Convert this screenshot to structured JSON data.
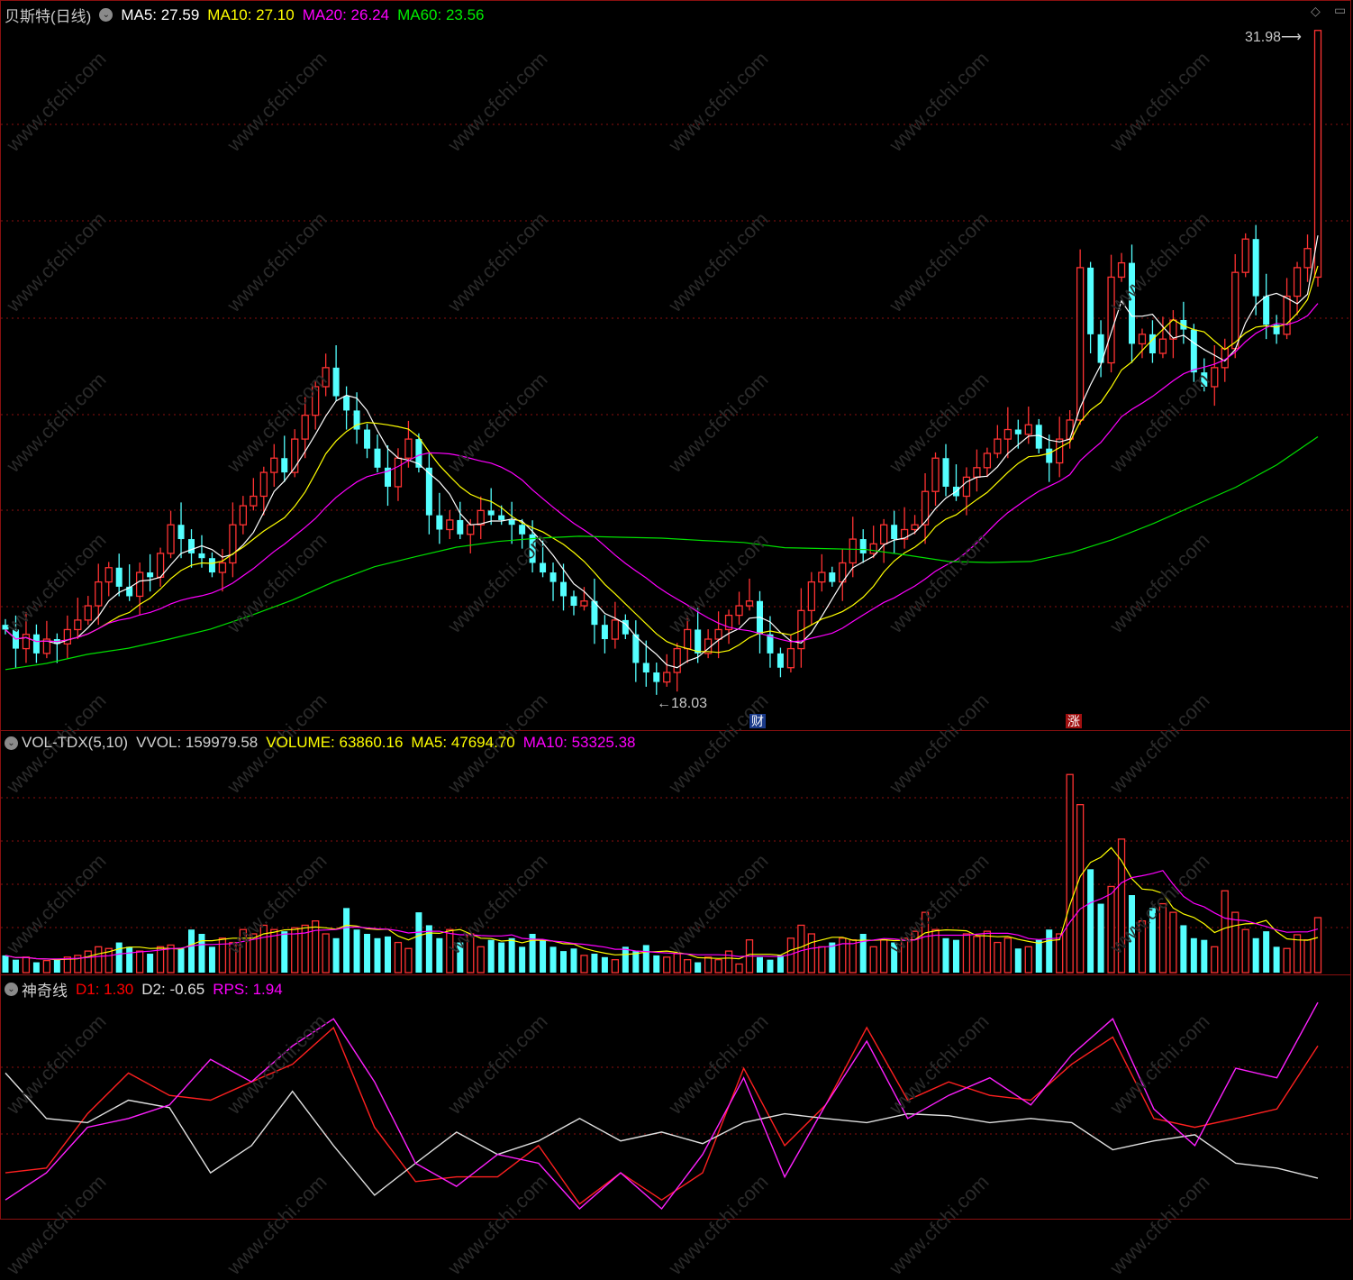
{
  "price_header": {
    "title": "贝斯特(日线)",
    "ma5": "MA5: 27.59",
    "ma10": "MA10: 27.10",
    "ma20": "MA20: 26.24",
    "ma60": "MA60: 23.56"
  },
  "volume_header": {
    "name": "VOL-TDX(5,10)",
    "vvol": "VVOL: 159979.58",
    "volume": "VOLUME: 63860.16",
    "ma5": "MA5: 47694.70",
    "ma10": "MA10: 53325.38"
  },
  "indicator_header": {
    "name": "神奇线",
    "d1": "D1: 1.30",
    "d2": "D2: -0.65",
    "rps": "RPS: 1.94"
  },
  "annotations": {
    "high_label": "31.98",
    "low_label": "18.03",
    "badge_finance": "财",
    "badge_limit_up": "涨"
  },
  "watermark": "www.cfchi.com",
  "colors": {
    "up": "#ff3232",
    "down": "#54ffff",
    "ma5": "#ffffff",
    "ma10": "#ffff00",
    "ma20": "#ff00ff",
    "ma60": "#00e000",
    "d1": "#ff2020",
    "d2": "#e0e0e0",
    "rps": "#ff20ff",
    "grid": "#8a1010"
  },
  "chart_data": [
    {
      "type": "candlestick",
      "title": "贝斯特(日线)",
      "ylim": [
        17.27,
        32.6
      ],
      "high": 31.98,
      "low": 18.03,
      "closes": [
        19.4,
        19.0,
        19.3,
        18.9,
        19.2,
        19.1,
        19.4,
        19.6,
        19.9,
        20.4,
        20.7,
        20.3,
        20.1,
        20.6,
        20.5,
        21.0,
        21.6,
        21.3,
        21.0,
        20.9,
        20.6,
        20.8,
        21.6,
        22.0,
        22.2,
        22.7,
        23.0,
        22.7,
        23.4,
        23.9,
        24.5,
        24.9,
        24.3,
        24.0,
        23.6,
        23.2,
        22.8,
        22.4,
        23.0,
        23.4,
        22.8,
        21.8,
        21.5,
        21.7,
        21.4,
        21.6,
        21.9,
        21.8,
        21.7,
        21.6,
        21.4,
        20.8,
        20.6,
        20.4,
        20.1,
        19.9,
        20.0,
        19.5,
        19.2,
        19.6,
        19.3,
        18.7,
        18.5,
        18.3,
        18.5,
        19.0,
        19.4,
        18.9,
        19.2,
        19.4,
        19.7,
        19.9,
        20.0,
        19.3,
        18.9,
        18.6,
        19.0,
        19.8,
        20.4,
        20.6,
        20.4,
        20.8,
        21.3,
        21.0,
        21.2,
        21.6,
        21.3,
        21.5,
        21.6,
        22.3,
        23.0,
        22.4,
        22.2,
        22.6,
        22.8,
        23.1,
        23.4,
        23.6,
        23.5,
        23.7,
        23.2,
        22.9,
        23.4,
        23.8,
        27.0,
        25.6,
        25.0,
        26.8,
        27.1,
        25.4,
        25.6,
        25.2,
        25.5,
        25.9,
        25.7,
        24.8,
        24.5,
        24.9,
        25.3,
        26.9,
        27.6,
        26.4,
        25.8,
        25.6,
        26.4,
        27.0,
        27.4,
        31.98
      ],
      "ma60_sampled": [
        18.56,
        18.69,
        18.88,
        19.01,
        19.2,
        19.41,
        19.7,
        20.02,
        20.4,
        20.72,
        20.93,
        21.13,
        21.25,
        21.32,
        21.36,
        21.34,
        21.32,
        21.27,
        21.23,
        21.12,
        21.1,
        21.08,
        20.96,
        20.83,
        20.81,
        20.83,
        21.02,
        21.29,
        21.63,
        22.01,
        22.39,
        22.86,
        23.45
      ]
    },
    {
      "type": "bar",
      "title": "VOL-TDX(5,10)",
      "ylim": [
        0,
        270000
      ],
      "values_thousands": [
        20,
        15,
        18,
        12,
        14,
        16,
        18,
        20,
        25,
        30,
        28,
        35,
        30,
        25,
        22,
        30,
        32,
        28,
        50,
        45,
        30,
        40,
        35,
        50,
        45,
        55,
        50,
        48,
        52,
        55,
        60,
        45,
        40,
        75,
        50,
        45,
        40,
        42,
        35,
        28,
        70,
        55,
        40,
        50,
        35,
        45,
        30,
        38,
        35,
        40,
        30,
        45,
        38,
        30,
        25,
        28,
        20,
        22,
        18,
        15,
        30,
        25,
        32,
        20,
        18,
        22,
        15,
        12,
        18,
        15,
        25,
        10,
        38,
        18,
        15,
        20,
        40,
        55,
        45,
        30,
        35,
        40,
        38,
        45,
        30,
        38,
        35,
        40,
        48,
        70,
        50,
        40,
        38,
        45,
        42,
        48,
        35,
        40,
        28,
        30,
        38,
        50,
        45,
        230,
        195,
        120,
        80,
        100,
        155,
        90,
        60,
        75,
        80,
        70,
        55,
        40,
        38,
        30,
        95,
        70,
        50,
        40,
        48,
        30,
        28,
        44,
        38,
        63.86
      ]
    },
    {
      "type": "line",
      "title": "神奇线",
      "ylim": [
        -1.26,
        2.34
      ],
      "series": [
        {
          "name": "D1",
          "values": [
            -0.57,
            -0.5,
            0.3,
            0.9,
            0.57,
            0.5,
            0.77,
            1.03,
            1.57,
            0.1,
            -0.7,
            -0.63,
            -0.63,
            -0.17,
            -1.03,
            -0.57,
            -0.97,
            -0.57,
            0.97,
            -0.17,
            0.43,
            1.57,
            0.5,
            0.77,
            0.57,
            0.5,
            1.03,
            1.43,
            0.23,
            0.1,
            0.23,
            0.37,
            1.3
          ]
        },
        {
          "name": "D2",
          "values": [
            0.9,
            0.23,
            0.17,
            0.5,
            0.39,
            -0.57,
            -0.17,
            0.63,
            -0.17,
            -0.9,
            -0.43,
            0.03,
            -0.3,
            -0.1,
            0.23,
            -0.1,
            0.03,
            -0.14,
            0.17,
            0.3,
            0.23,
            0.17,
            0.3,
            0.27,
            0.17,
            0.23,
            0.17,
            -0.23,
            -0.1,
            -0.01,
            -0.43,
            -0.5,
            -0.65
          ]
        },
        {
          "name": "RPS",
          "values": [
            -0.97,
            -0.57,
            0.1,
            0.23,
            0.43,
            1.1,
            0.77,
            1.3,
            1.7,
            0.77,
            -0.43,
            -0.77,
            -0.3,
            -0.43,
            -1.1,
            -0.57,
            -1.1,
            -0.3,
            0.83,
            -0.63,
            0.43,
            1.37,
            0.23,
            0.57,
            0.83,
            0.43,
            1.17,
            1.7,
            0.37,
            -0.17,
            0.97,
            0.83,
            1.94
          ]
        }
      ]
    }
  ]
}
